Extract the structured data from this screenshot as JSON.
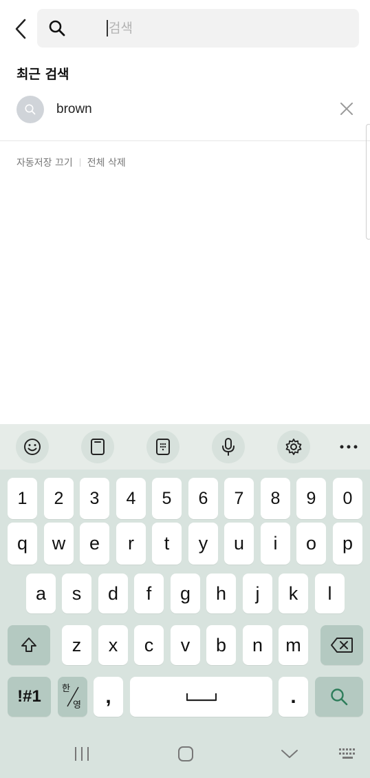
{
  "search": {
    "placeholder": "검색",
    "value": ""
  },
  "recent": {
    "title": "최근 검색",
    "items": [
      {
        "text": "brown"
      }
    ]
  },
  "footer": {
    "auto_save_off": "자동저장 끄기",
    "delete_all": "전체 삭제"
  },
  "keyboard": {
    "toolbar": [
      "emoji-icon",
      "clipboard-icon",
      "keypad-icon",
      "microphone-icon",
      "gear-icon",
      "more-icon"
    ],
    "row_numbers": [
      "1",
      "2",
      "3",
      "4",
      "5",
      "6",
      "7",
      "8",
      "9",
      "0"
    ],
    "row1": [
      "q",
      "w",
      "e",
      "r",
      "t",
      "y",
      "u",
      "i",
      "o",
      "p"
    ],
    "row2": [
      "a",
      "s",
      "d",
      "f",
      "g",
      "h",
      "j",
      "k",
      "l"
    ],
    "row3": [
      "z",
      "x",
      "c",
      "v",
      "b",
      "n",
      "m"
    ],
    "symbols_label": "!#1",
    "lang_top": "한",
    "lang_bottom": "영",
    "comma": ",",
    "period": "."
  },
  "colors": {
    "keyboard_bg": "#d8e3de",
    "func_key": "#b4c9c1",
    "accent": "#2e7d5b"
  }
}
